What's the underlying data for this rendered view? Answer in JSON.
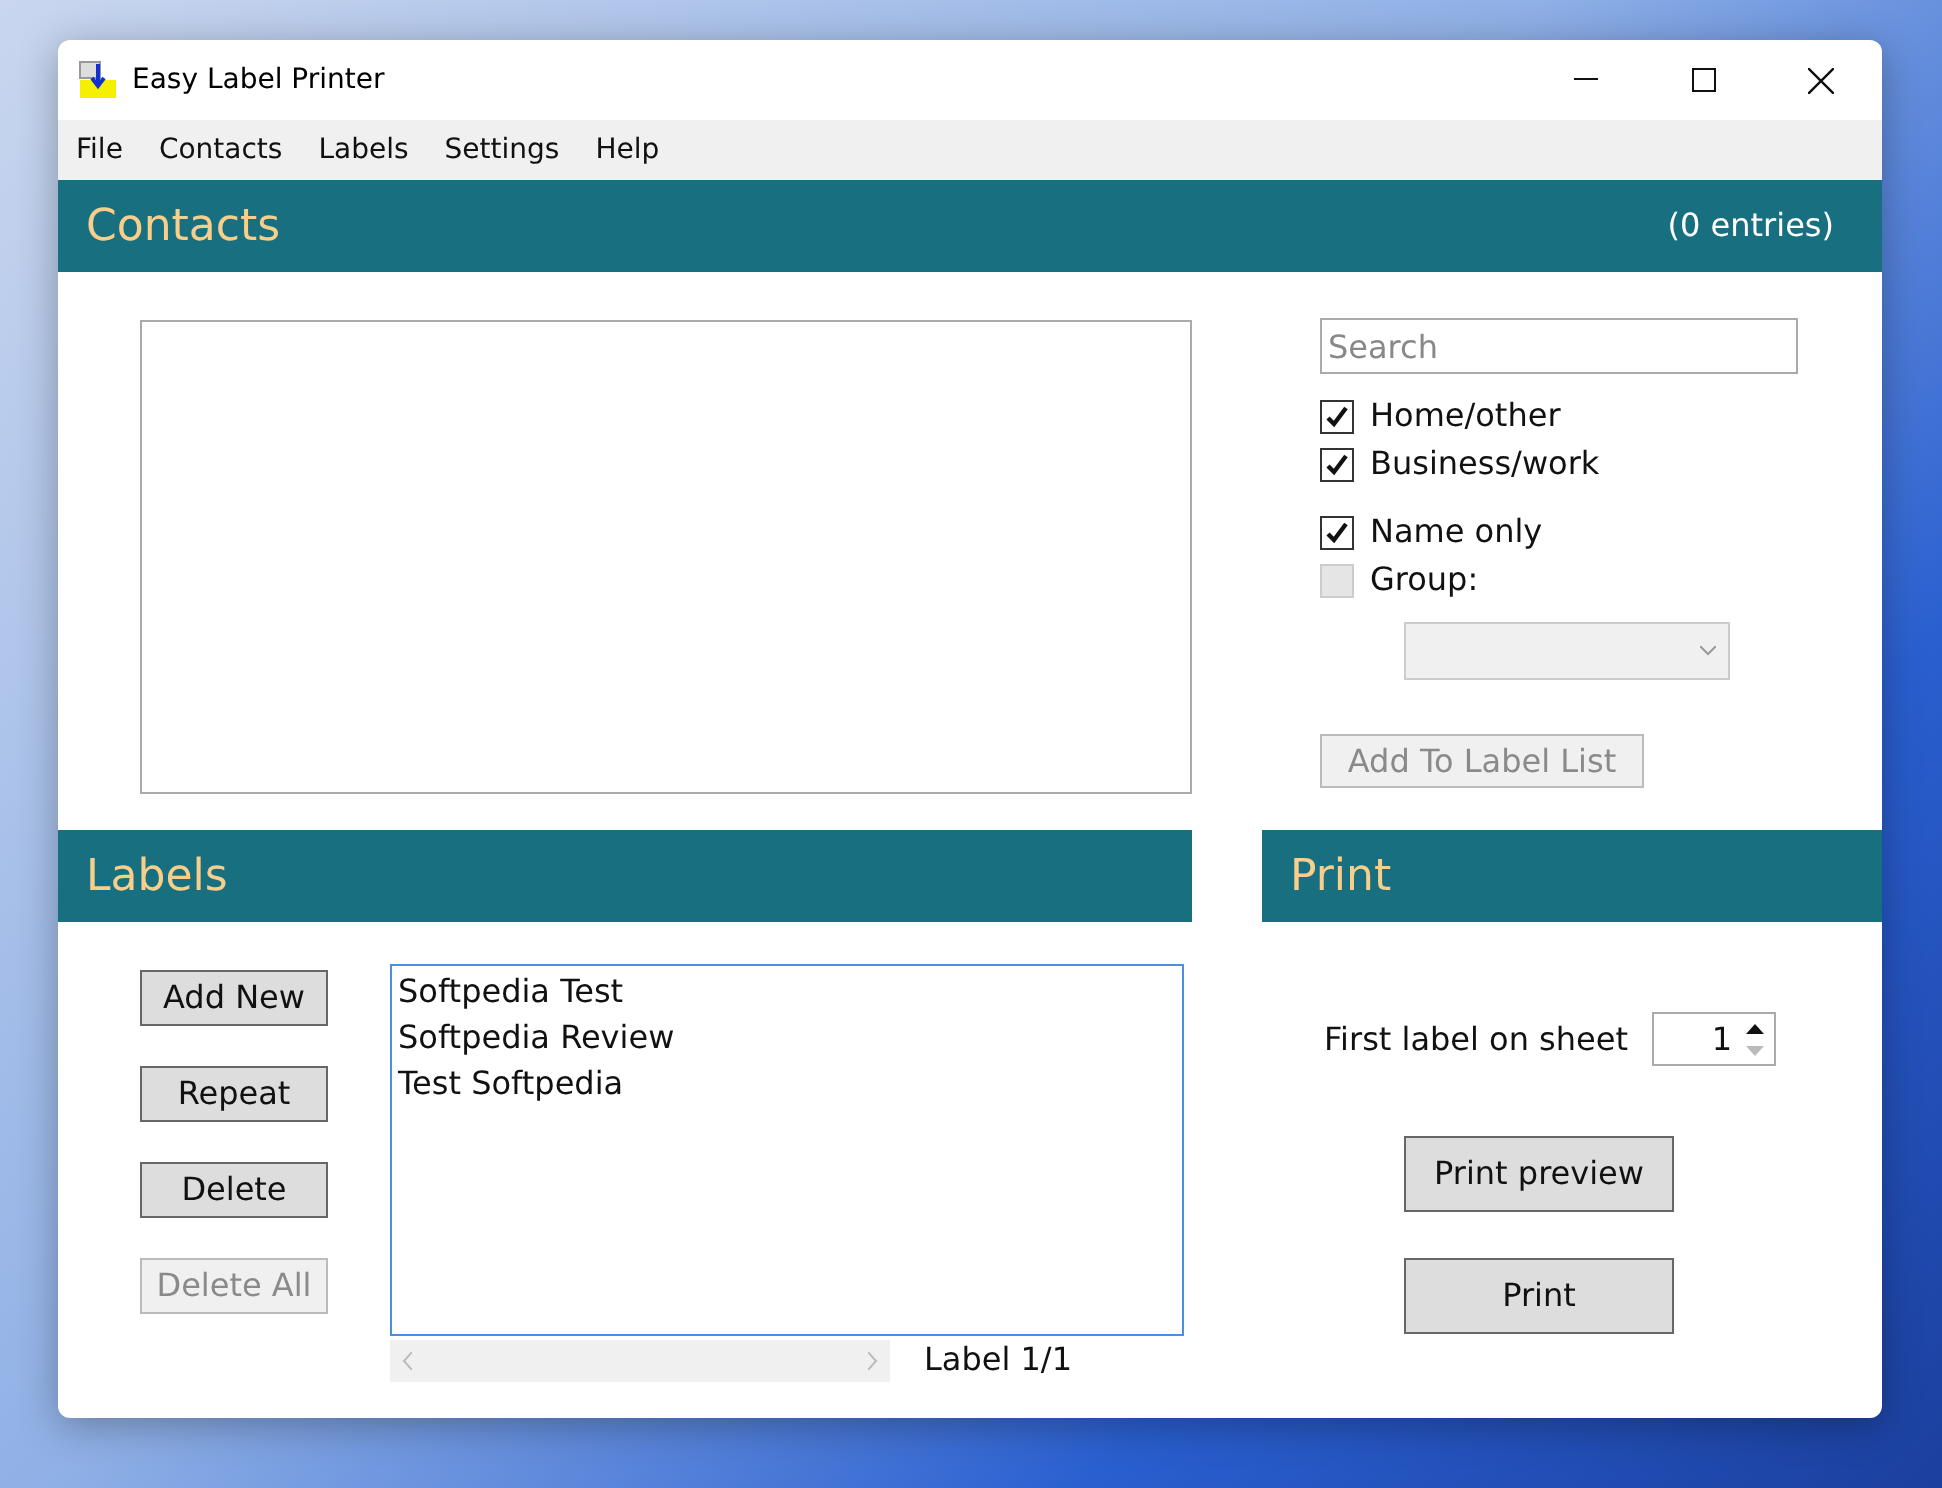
{
  "window": {
    "title": "Easy Label Printer"
  },
  "menu": [
    "File",
    "Contacts",
    "Labels",
    "Settings",
    "Help"
  ],
  "contacts": {
    "title": "Contacts",
    "count": "(0 entries)",
    "search": {
      "placeholder": "Search"
    },
    "options": [
      {
        "label": "Home/other",
        "checked": true
      },
      {
        "label": "Business/work",
        "checked": true
      },
      {
        "label": "Name only",
        "checked": true
      },
      {
        "label": "Group:",
        "checked": false
      }
    ],
    "group_dropdown": {
      "disabled": true
    },
    "add_button": {
      "label": "Add To Label List",
      "disabled": true
    }
  },
  "labels": {
    "title": "Labels",
    "buttons": [
      {
        "label": "Add New",
        "disabled": false
      },
      {
        "label": "Repeat",
        "disabled": false
      },
      {
        "label": "Delete",
        "disabled": false
      },
      {
        "label": "Delete All",
        "disabled": true
      }
    ],
    "lines": [
      "Softpedia Test",
      "Softpedia Review",
      "Test Softpedia"
    ],
    "counter": "Label 1/1"
  },
  "print": {
    "title": "Print",
    "first_label": {
      "label": "First label on sheet",
      "value": "1"
    },
    "buttons": [
      {
        "label": "Print preview"
      },
      {
        "label": "Print"
      }
    ]
  }
}
